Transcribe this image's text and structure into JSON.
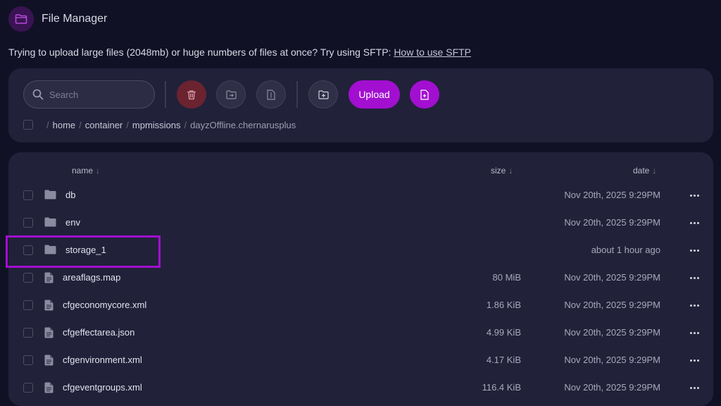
{
  "header": {
    "title": "File Manager",
    "icon": "folder-icon"
  },
  "notice": {
    "text": "Trying to upload large files (2048mb) or huge numbers of files at once? Try using SFTP:",
    "link": "How to use SFTP"
  },
  "toolbar": {
    "search_placeholder": "Search",
    "upload_label": "Upload"
  },
  "breadcrumb": [
    "home",
    "container",
    "mpmissions",
    "dayzOffline.chernarusplus"
  ],
  "columns": {
    "name": "name",
    "size": "size",
    "date": "date",
    "sort_arrow": "↓"
  },
  "files": [
    {
      "name": "db",
      "type": "folder",
      "size": "",
      "date": "Nov 20th, 2025 9:29PM"
    },
    {
      "name": "env",
      "type": "folder",
      "size": "",
      "date": "Nov 20th, 2025 9:29PM"
    },
    {
      "name": "storage_1",
      "type": "folder",
      "size": "",
      "date": "about 1 hour ago"
    },
    {
      "name": "areaflags.map",
      "type": "file",
      "size": "80 MiB",
      "date": "Nov 20th, 2025 9:29PM"
    },
    {
      "name": "cfgeconomycore.xml",
      "type": "file",
      "size": "1.86 KiB",
      "date": "Nov 20th, 2025 9:29PM"
    },
    {
      "name": "cfgeffectarea.json",
      "type": "file",
      "size": "4.99 KiB",
      "date": "Nov 20th, 2025 9:29PM"
    },
    {
      "name": "cfgenvironment.xml",
      "type": "file",
      "size": "4.17 KiB",
      "date": "Nov 20th, 2025 9:29PM"
    },
    {
      "name": "cfgeventgroups.xml",
      "type": "file",
      "size": "116.4 KiB",
      "date": "Nov 20th, 2025 9:29PM"
    }
  ],
  "colors": {
    "accent": "#a20fd0",
    "delete": "#6b2330",
    "background": "#111126",
    "card": "#21213a"
  }
}
